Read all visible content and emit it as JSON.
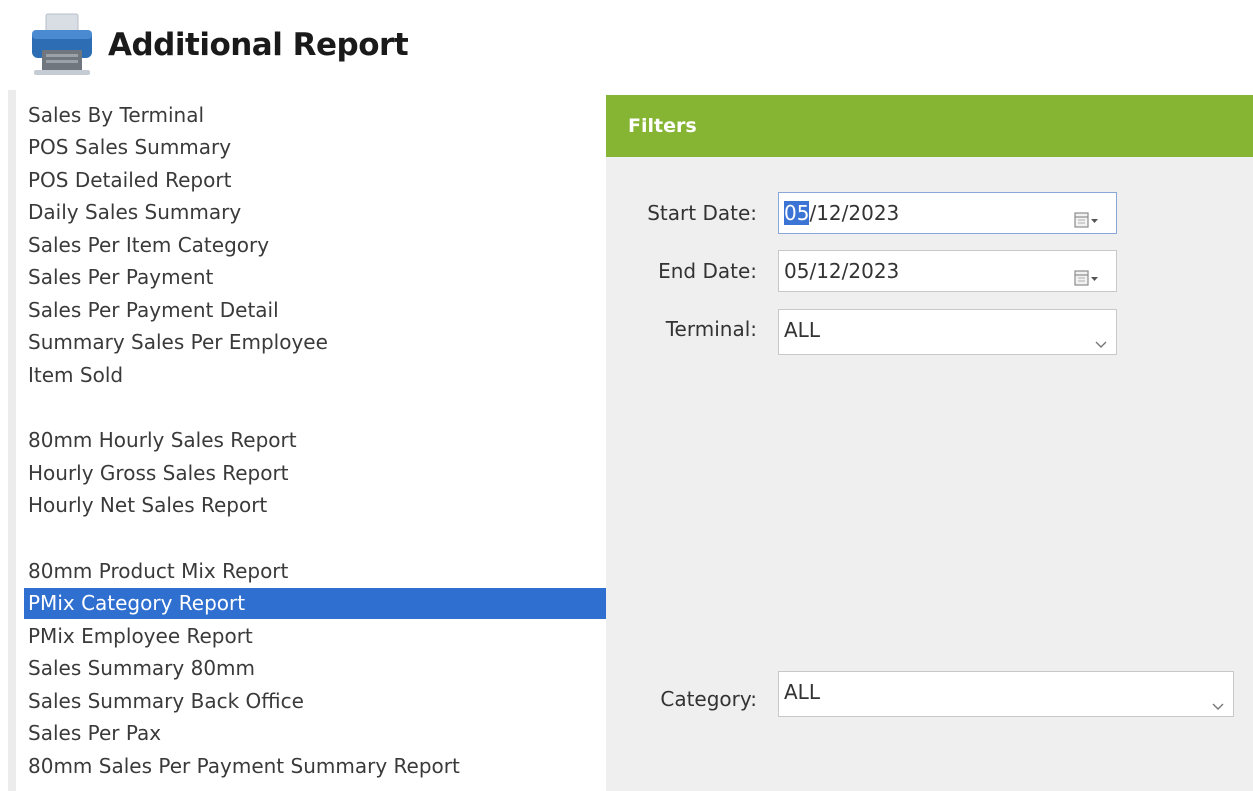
{
  "header": {
    "title": "Additional Report",
    "icon": "printer-icon"
  },
  "reports": [
    {
      "label": "Sales By Terminal",
      "selected": false
    },
    {
      "label": "POS Sales Summary",
      "selected": false
    },
    {
      "label": "POS Detailed Report",
      "selected": false
    },
    {
      "label": "Daily Sales Summary",
      "selected": false
    },
    {
      "label": "Sales Per Item Category",
      "selected": false
    },
    {
      "label": "Sales Per Payment",
      "selected": false
    },
    {
      "label": "Sales Per Payment Detail",
      "selected": false
    },
    {
      "label": "Summary Sales Per Employee",
      "selected": false
    },
    {
      "label": "Item Sold",
      "selected": false
    },
    {
      "label": "80mm Hourly Sales Report",
      "selected": false
    },
    {
      "label": "Hourly Gross Sales Report",
      "selected": false
    },
    {
      "label": "Hourly Net Sales Report",
      "selected": false
    },
    {
      "label": "80mm Product Mix Report",
      "selected": false
    },
    {
      "label": "PMix Category Report",
      "selected": true
    },
    {
      "label": "PMix Employee Report",
      "selected": false
    },
    {
      "label": "Sales Summary 80mm",
      "selected": false
    },
    {
      "label": "Sales Summary Back Office",
      "selected": false
    },
    {
      "label": "Sales Per Pax",
      "selected": false
    },
    {
      "label": "80mm Sales Per Payment Summary Report",
      "selected": false
    }
  ],
  "filters": {
    "title": "Filters",
    "start_date": {
      "label": "Start Date:",
      "value_selected": "05",
      "value_rest": "/12/2023"
    },
    "end_date": {
      "label": "End Date:",
      "value": "05/12/2023"
    },
    "terminal": {
      "label": "Terminal:",
      "value": "ALL"
    },
    "category": {
      "label": "Category:",
      "value": "ALL"
    }
  },
  "colors": {
    "accent_green": "#86b533",
    "selection_blue": "#2f6fd0",
    "panel_bg": "#efefef"
  }
}
